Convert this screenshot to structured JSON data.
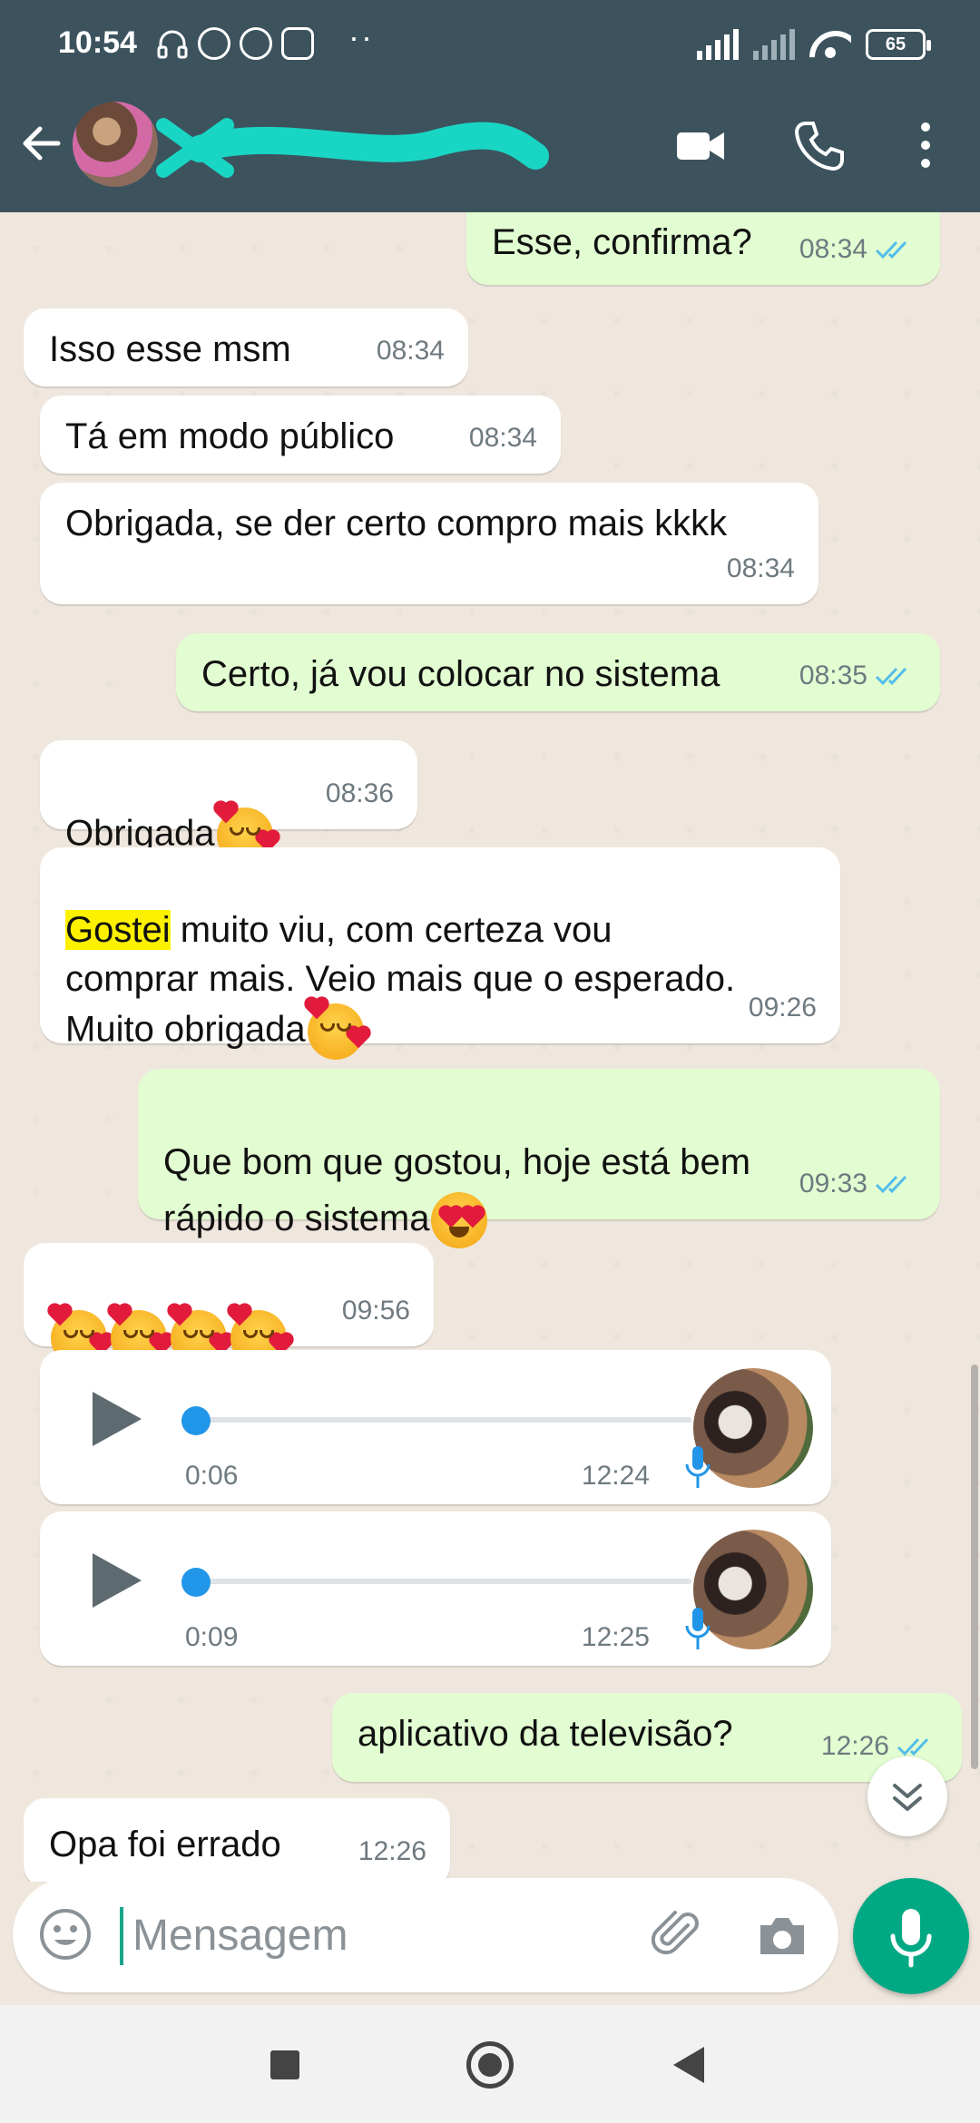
{
  "status_bar": {
    "time": "10:54",
    "battery": "65"
  },
  "header": {
    "contact_name": "",
    "icons": [
      "back-arrow-icon",
      "video-call-icon",
      "phone-icon",
      "more-vert-icon"
    ]
  },
  "messages": [
    {
      "dir": "out",
      "text": "Esse, confirma?",
      "time": "08:34",
      "ticks": "read"
    },
    {
      "dir": "in",
      "text": "Isso esse msm",
      "time": "08:34"
    },
    {
      "dir": "in",
      "text": "Tá em modo público",
      "time": "08:34"
    },
    {
      "dir": "in",
      "text": "Obrigada, se der certo compro mais kkkk",
      "time": "08:34"
    },
    {
      "dir": "out",
      "text": "Certo, já vou colocar no sistema",
      "time": "08:35",
      "ticks": "read"
    },
    {
      "dir": "in",
      "text": "Obrigada",
      "emoji": "smiling-face-with-hearts",
      "time": "08:36"
    },
    {
      "dir": "in",
      "highlight": "Gostei",
      "text_after": " muito viu, com certeza vou\ncomprar mais. Veio mais que o esperado.\nMuito obrigada",
      "emoji": "smiling-face-with-hearts",
      "time": "09:26"
    },
    {
      "dir": "out",
      "text": "Que bom que gostou, hoje está bem\nrápido o sistema",
      "emoji": "heart-eyes",
      "time": "09:33",
      "ticks": "read"
    },
    {
      "dir": "in",
      "emojis": [
        "smiling-face-with-hearts",
        "smiling-face-with-hearts",
        "smiling-face-with-hearts",
        "smiling-face-with-hearts"
      ],
      "time": "09:56"
    },
    {
      "dir": "in",
      "type": "audio",
      "duration": "0:06",
      "time": "12:24"
    },
    {
      "dir": "in",
      "type": "audio",
      "duration": "0:09",
      "time": "12:25"
    },
    {
      "dir": "out",
      "text": "aplicativo da televisão?",
      "time": "12:26",
      "ticks": "read"
    },
    {
      "dir": "in",
      "text": "Opa foi errado",
      "time": "12:26"
    }
  ],
  "composer": {
    "placeholder": "Mensagem"
  },
  "colors": {
    "header": "#3c535e",
    "outgoing": "#e2fdd1",
    "incoming": "#ffffff",
    "accent": "#00a884",
    "ticks": "#53bdeb"
  }
}
